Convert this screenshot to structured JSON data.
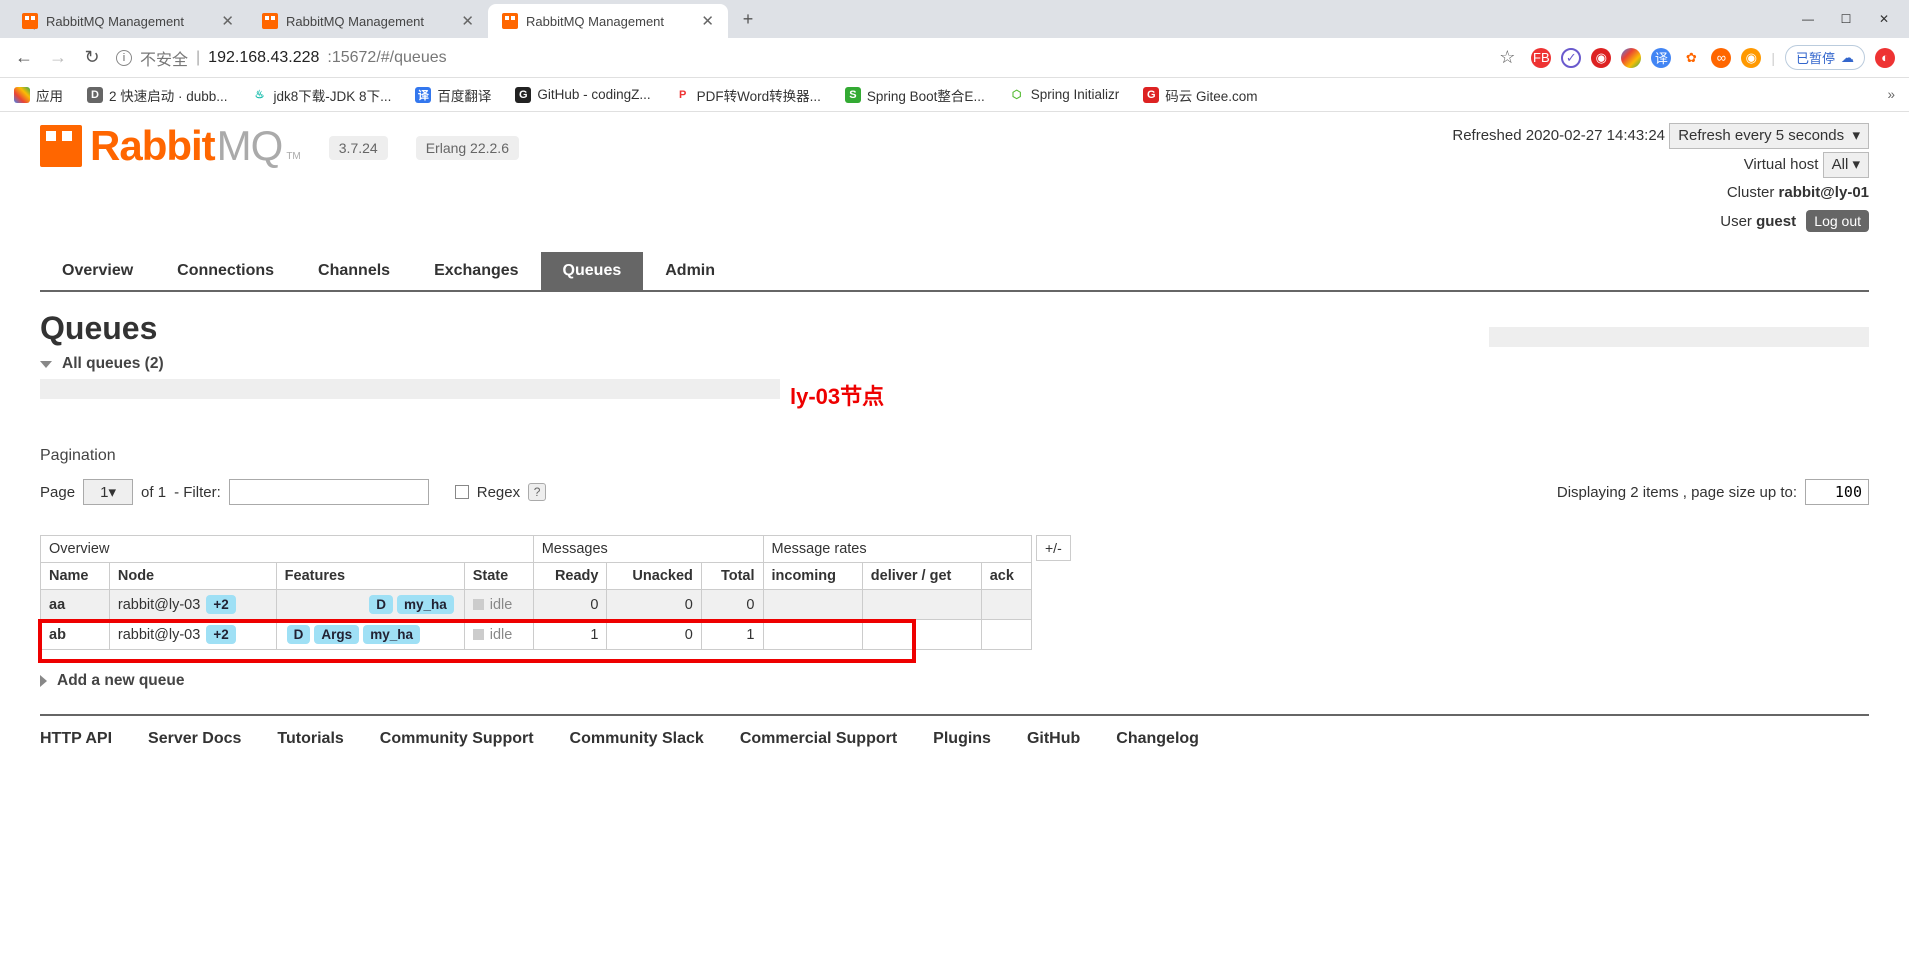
{
  "browser": {
    "tabs": [
      {
        "title": "RabbitMQ Management",
        "active": false
      },
      {
        "title": "RabbitMQ Management",
        "active": false
      },
      {
        "title": "RabbitMQ Management",
        "active": true
      }
    ],
    "window_controls": {
      "min": "—",
      "max": "☐",
      "close": "✕"
    },
    "back": "←",
    "forward": "→",
    "reload": "↻",
    "address": {
      "insecure_label": "不安全",
      "host": "192.168.43.228",
      "port_path": ":15672/#/queues"
    },
    "star": "☆",
    "paused_label": "已暂停",
    "bookmarks": [
      {
        "label": "应用"
      },
      {
        "label": "2 快速启动 · dubb..."
      },
      {
        "label": "jdk8下载-JDK 8下..."
      },
      {
        "label": "百度翻译"
      },
      {
        "label": "GitHub - codingZ..."
      },
      {
        "label": "PDF转Word转换器..."
      },
      {
        "label": "Spring Boot整合E..."
      },
      {
        "label": "Spring Initializr"
      },
      {
        "label": "码云 Gitee.com"
      }
    ]
  },
  "rabbit": {
    "logo1": "Rabbit",
    "logo2": "MQ",
    "tm": "TM",
    "version": "3.7.24",
    "erlang": "Erlang 22.2.6",
    "refreshed_label": "Refreshed 2020-02-27 14:43:24",
    "refresh_select": "Refresh every 5 seconds",
    "vhost_label": "Virtual host",
    "vhost_value": "All",
    "cluster_label": "Cluster",
    "cluster_value": "rabbit@ly-01",
    "user_label": "User",
    "user_value": "guest",
    "logout": "Log out",
    "tabs": [
      "Overview",
      "Connections",
      "Channels",
      "Exchanges",
      "Queues",
      "Admin"
    ],
    "active_tab": "Queues",
    "title": "Queues",
    "section": "All queues (2)",
    "annotation": "ly-03节点",
    "pagination_label": "Pagination",
    "page_label": "Page",
    "page_value": "1",
    "of_label": "of 1",
    "filter_label": "- Filter:",
    "regex_label": "Regex",
    "regex_q": "?",
    "displaying": "Displaying 2 items , page size up to:",
    "pagesize": "100",
    "table_groups": [
      "Overview",
      "Messages",
      "Message rates"
    ],
    "pm_toggle": "+/-",
    "cols": [
      "Name",
      "Node",
      "Features",
      "State",
      "Ready",
      "Unacked",
      "Total",
      "incoming",
      "deliver / get",
      "ack"
    ],
    "rows": [
      {
        "name": "aa",
        "node": "rabbit@ly-03",
        "mirror": "+2",
        "features": [
          "D",
          "my_ha"
        ],
        "state": "idle",
        "ready": "0",
        "unacked": "0",
        "total": "0",
        "incoming": "",
        "deliver": "",
        "ack": ""
      },
      {
        "name": "ab",
        "node": "rabbit@ly-03",
        "mirror": "+2",
        "features": [
          "D",
          "Args",
          "my_ha"
        ],
        "state": "idle",
        "ready": "1",
        "unacked": "0",
        "total": "1",
        "incoming": "",
        "deliver": "",
        "ack": ""
      }
    ],
    "add_queue": "Add a new queue",
    "footer": [
      "HTTP API",
      "Server Docs",
      "Tutorials",
      "Community Support",
      "Community Slack",
      "Commercial Support",
      "Plugins",
      "GitHub",
      "Changelog"
    ]
  }
}
